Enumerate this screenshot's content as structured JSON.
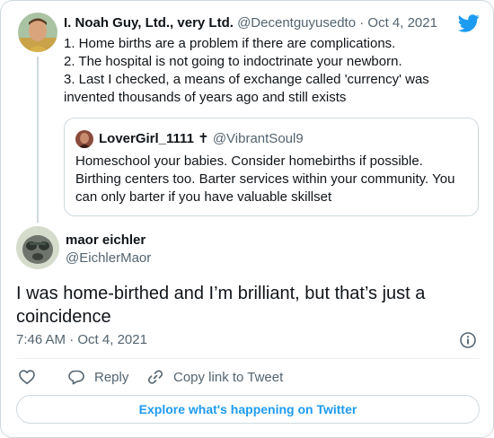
{
  "parent": {
    "author_name": "I. Noah Guy, Ltd., very Ltd.",
    "author_handle": "@Decentguyusedto",
    "separator": "·",
    "date": "Oct 4, 2021",
    "text_lines": [
      "1. Home births are a problem if there are complications.",
      "2. The hospital is not going to indoctrinate your newborn.",
      "3. Last I checked, a means of exchange called 'currency' was",
      "invented thousands of years ago and still exists"
    ]
  },
  "quoted": {
    "author_name": "LoverGirl_1111 ✝",
    "author_handle": "@VibrantSoul9",
    "text_lines": [
      "Homeschool your babies. Consider homebirths if possible.",
      "Birthing centers too. Barter services within your community. You",
      "can only barter if you have valuable skillset"
    ]
  },
  "tweet": {
    "author_name": "maor eichler",
    "author_handle": "@EichlerMaor",
    "text_lines": [
      "I was home-birthed and I’m brilliant, but that’s just a",
      "coincidence"
    ],
    "time": "7:46 AM",
    "separator": "·",
    "date": "Oct 4, 2021"
  },
  "actions": {
    "like_icon": "heart-icon",
    "reply_label": "Reply",
    "reply_icon": "speech-bubble-icon",
    "copy_label": "Copy link to Tweet",
    "copy_icon": "link-icon",
    "info_icon": "info-icon"
  },
  "explore_button": {
    "label": "Explore what's happening on Twitter"
  },
  "colors": {
    "brand_blue": "#1d9bf0",
    "secondary_text": "#536471",
    "border": "#cfd9de"
  }
}
